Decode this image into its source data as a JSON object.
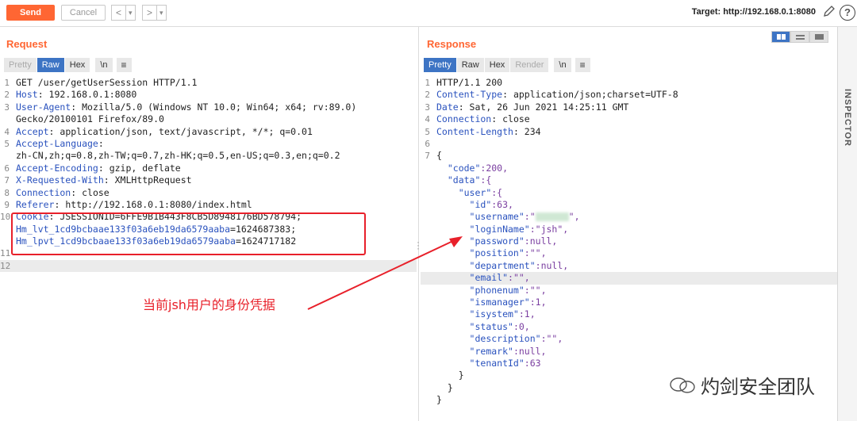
{
  "toolbar": {
    "send_label": "Send",
    "cancel_label": "Cancel",
    "back_glyph": "<",
    "forward_glyph": ">",
    "dropdown_glyph": "▾",
    "target_label": "Target: http://192.168.0.1:8080",
    "edit_icon": "pencil-icon",
    "help_icon": "?"
  },
  "request": {
    "title": "Request",
    "tabs": [
      "Pretty",
      "Raw",
      "Hex",
      "\\n",
      "≡"
    ],
    "active_tab": "Raw",
    "lines": [
      {
        "n": "1",
        "key": "",
        "val": "GET /user/getUserSession HTTP/1.1"
      },
      {
        "n": "2",
        "key": "Host",
        "val": ": 192.168.0.1:8080"
      },
      {
        "n": "3",
        "key": "User-Agent",
        "val": ": Mozilla/5.0 (Windows NT 10.0; Win64; x64; rv:89.0)"
      },
      {
        "n": "",
        "key": "",
        "val": "Gecko/20100101 Firefox/89.0"
      },
      {
        "n": "4",
        "key": "Accept",
        "val": ": application/json, text/javascript, */*; q=0.01"
      },
      {
        "n": "5",
        "key": "Accept-Language",
        "val": ":"
      },
      {
        "n": "",
        "key": "",
        "val": "zh-CN,zh;q=0.8,zh-TW;q=0.7,zh-HK;q=0.5,en-US;q=0.3,en;q=0.2"
      },
      {
        "n": "6",
        "key": "Accept-Encoding",
        "val": ": gzip, deflate"
      },
      {
        "n": "7",
        "key": "X-Requested-With",
        "val": ": XMLHttpRequest"
      },
      {
        "n": "8",
        "key": "Connection",
        "val": ": close"
      },
      {
        "n": "9",
        "key": "Referer",
        "val": ": http://192.168.0.1:8080/index.html"
      },
      {
        "n": "10",
        "key": "Cookie",
        "val": ": JSESSIONID=6FFE9B1B443F8CB5D8948176BD578794;"
      },
      {
        "n": "",
        "key": "Hm_lvt_1cd9bcbaae133f03a6eb19da6579aaba",
        "val": "=1624687383;"
      },
      {
        "n": "",
        "key": "Hm_lpvt_1cd9bcbaae133f03a6eb19da6579aaba",
        "val": "=1624717182"
      },
      {
        "n": "11",
        "key": "",
        "val": ""
      },
      {
        "n": "12",
        "key": "",
        "val": ""
      }
    ],
    "annotation": "当前jsh用户的身份凭据"
  },
  "response": {
    "title": "Response",
    "tabs": [
      "Pretty",
      "Raw",
      "Hex",
      "Render",
      "\\n",
      "≡"
    ],
    "active_tab": "Pretty",
    "header_lines": [
      {
        "n": "1",
        "key": "",
        "val": "HTTP/1.1 200"
      },
      {
        "n": "2",
        "key": "Content-Type",
        "val": ": application/json;charset=UTF-8"
      },
      {
        "n": "3",
        "key": "Date",
        "val": ": Sat, 26 Jun 2021 14:25:11 GMT"
      },
      {
        "n": "4",
        "key": "Connection",
        "val": ": close"
      },
      {
        "n": "5",
        "key": "Content-Length",
        "val": ": 234"
      },
      {
        "n": "6",
        "key": "",
        "val": ""
      },
      {
        "n": "7",
        "key": "",
        "val": "{"
      }
    ],
    "json_lines": [
      {
        "indent": "  ",
        "key": "\"code\"",
        "val": ":200,"
      },
      {
        "indent": "  ",
        "key": "\"data\"",
        "val": ":{"
      },
      {
        "indent": "    ",
        "key": "\"user\"",
        "val": ":{"
      },
      {
        "indent": "      ",
        "key": "\"id\"",
        "val": ":63,"
      },
      {
        "indent": "      ",
        "key": "\"username\"",
        "val": ":\"",
        "blur": true,
        "tail": "\","
      },
      {
        "indent": "      ",
        "key": "\"loginName\"",
        "val": ":\"jsh\","
      },
      {
        "indent": "      ",
        "key": "\"password\"",
        "val": ":null,"
      },
      {
        "indent": "      ",
        "key": "\"position\"",
        "val": ":\"\","
      },
      {
        "indent": "      ",
        "key": "\"department\"",
        "val": ":null,"
      },
      {
        "indent": "      ",
        "key": "\"email\"",
        "val": ":\"\",",
        "highlight": true
      },
      {
        "indent": "      ",
        "key": "\"phonenum\"",
        "val": ":\"\","
      },
      {
        "indent": "      ",
        "key": "\"ismanager\"",
        "val": ":1,"
      },
      {
        "indent": "      ",
        "key": "\"isystem\"",
        "val": ":1,"
      },
      {
        "indent": "      ",
        "key": "\"status\"",
        "val": ":0,"
      },
      {
        "indent": "      ",
        "key": "\"description\"",
        "val": ":\"\","
      },
      {
        "indent": "      ",
        "key": "\"remark\"",
        "val": ":null,"
      },
      {
        "indent": "      ",
        "key": "\"tenantId\"",
        "val": ":63"
      },
      {
        "indent": "    ",
        "key": "",
        "val": "}"
      },
      {
        "indent": "  ",
        "key": "",
        "val": "}"
      },
      {
        "indent": "",
        "key": "",
        "val": "}"
      }
    ]
  },
  "inspector_label": "INSPECTOR",
  "watermark": "灼剑安全团队",
  "colors": {
    "accent": "#ff6633",
    "active_tab": "#3d74c4",
    "annotation": "#e8202a"
  }
}
